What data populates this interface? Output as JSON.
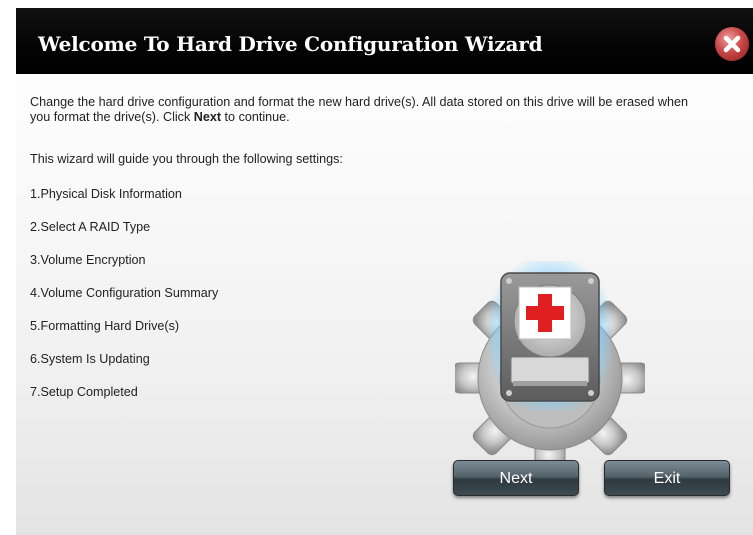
{
  "dialog": {
    "title": "Welcome To Hard Drive Configuration Wizard",
    "close_icon": "close-icon"
  },
  "content": {
    "intro_part1": "Change the hard drive configuration and format the new hard drive(s). All data stored on this drive will be erased when you format the drive(s). Click ",
    "intro_bold": "Next",
    "intro_part2": " to continue.",
    "guide_text": "This wizard will guide you through the following settings:",
    "steps": [
      "1.Physical Disk Information",
      "2.Select A RAID Type",
      "3.Volume Encryption",
      "4.Volume Configuration Summary",
      "5.Formatting Hard Drive(s)",
      "6.System Is Updating",
      "7.Setup Completed"
    ],
    "illustration_icon": "hard-drive-repair-icon"
  },
  "buttons": {
    "next_label": "Next",
    "exit_label": "Exit"
  },
  "colors": {
    "titlebar": "#000000",
    "close_button": "#c84848",
    "button": "#54636b",
    "cross": "#e02020"
  }
}
